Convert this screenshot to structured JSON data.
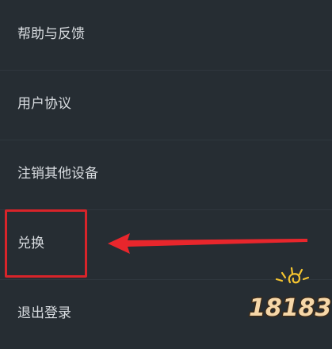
{
  "menu": {
    "items": [
      {
        "label": "帮助与反馈"
      },
      {
        "label": "用户协议"
      },
      {
        "label": "注销其他设备"
      },
      {
        "label": "兑换"
      },
      {
        "label": "退出登录"
      }
    ]
  },
  "annotation": {
    "highlight_color": "#d8242a",
    "highlighted_item": "兑换"
  },
  "watermark": {
    "text": "18183"
  },
  "colors": {
    "background": "#262d33",
    "text": "#d9dde1",
    "accent_red": "#d8242a",
    "watermark_yellow": "#f4c430"
  }
}
